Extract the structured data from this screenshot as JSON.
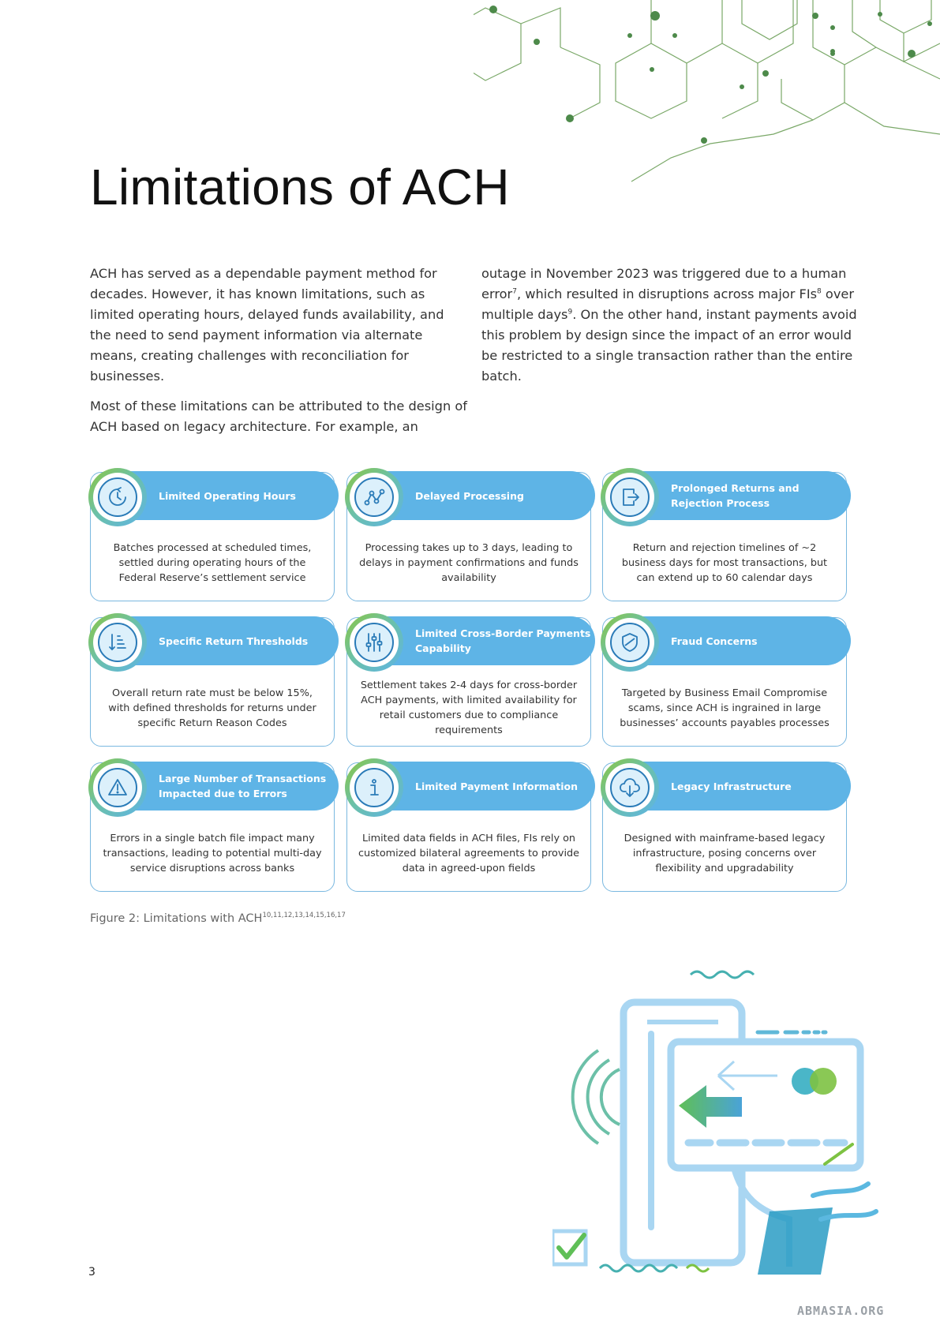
{
  "page": {
    "title": "Limitations of ACH",
    "page_number": "3",
    "watermark": "ABMASIA.ORG"
  },
  "intro": {
    "left": {
      "p1": "ACH has served as a dependable payment method for decades. However, it has known limitations, such as limited operating hours, delayed funds availability, and the need to send payment information via alternate means, creating challenges with reconciliation for businesses.",
      "p2": "Most of these limitations can be attributed to the design of ACH based on legacy architecture. For example, an"
    },
    "right": {
      "part1": "outage in November 2023 was triggered due to a human error",
      "sup1": "7",
      "part2": ", which resulted in disruptions across major FIs",
      "sup2": "8",
      "part3": " over multiple days",
      "sup3": "9",
      "part4": ". On the other hand, instant payments avoid this problem by design since the impact of an error would be restricted to a single transaction rather than the entire batch."
    }
  },
  "cards": [
    {
      "title": "Limited Operating Hours",
      "body": "Batches processed at scheduled times, settled during operating hours of the Federal Reserve’s settlement service",
      "icon": "clock-icon"
    },
    {
      "title": "Delayed Processing",
      "body": "Processing takes up to 3 days, leading to delays in payment confirmations and funds availability",
      "icon": "process-path-icon"
    },
    {
      "title": "Prolonged Returns and Rejection Process",
      "body": "Return and rejection timelines of ~2 business days for most transactions, but can extend up to 60 calendar days",
      "icon": "return-document-icon"
    },
    {
      "title": "Specific Return Thresholds",
      "body": "Overall return rate must be below 15%, with defined thresholds for returns under specific Return Reason Codes",
      "icon": "threshold-list-icon"
    },
    {
      "title": "Limited Cross-Border Payments Capability",
      "body": "Settlement takes 2-4 days for cross-border ACH payments, with limited availability for retail customers due to compliance requirements",
      "icon": "sliders-icon"
    },
    {
      "title": "Fraud Concerns",
      "body": "Targeted by Business Email Compromise scams, since ACH is ingrained in large businesses’ accounts payables processes",
      "icon": "shield-icon"
    },
    {
      "title": "Large Number of Transactions Impacted due to Errors",
      "body": "Errors in a single batch file impact many transactions, leading to potential multi-day service disruptions across banks",
      "icon": "warning-triangle-icon"
    },
    {
      "title": "Limited Payment Information",
      "body": "Limited data fields in ACH files, FIs rely on customized bilateral agreements to provide data in agreed-upon fields",
      "icon": "info-icon"
    },
    {
      "title": "Legacy Infrastructure",
      "body": "Designed with mainframe-based legacy infrastructure, posing concerns over flexibility and upgradability",
      "icon": "cloud-download-icon"
    }
  ],
  "figure": {
    "caption": "Figure 2: Limitations with ACH",
    "refs": "10,11,12,13,14,15,16,17"
  },
  "colors": {
    "header_blue": "#5eb4e6",
    "border_blue": "#7ab8e0",
    "accent_green": "#8cc63f",
    "icon_stroke": "#2a7bb8"
  }
}
